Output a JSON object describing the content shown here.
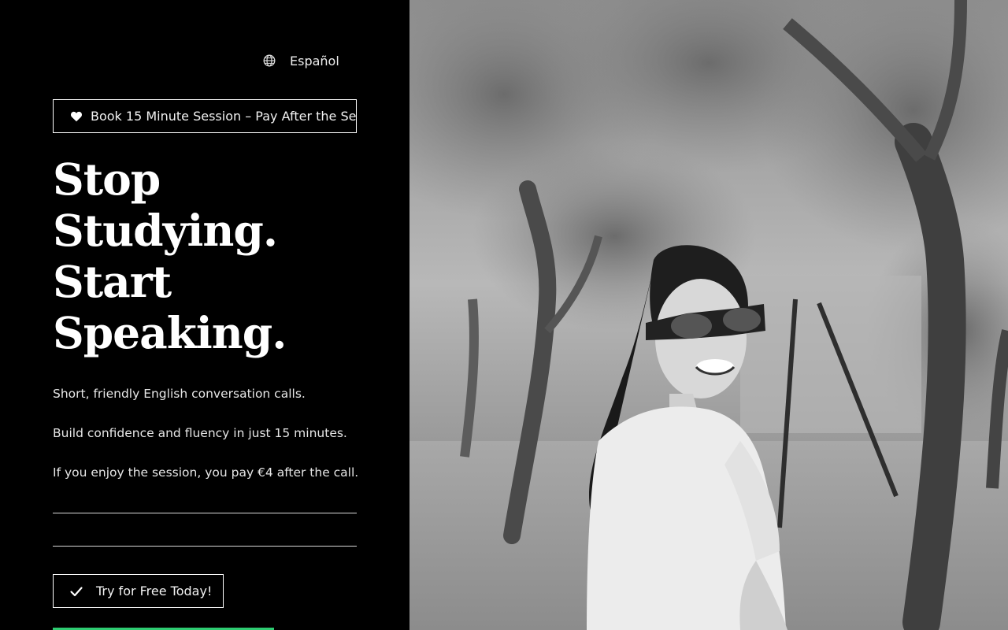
{
  "language_switch": {
    "label": "Español",
    "icon": "globe-icon"
  },
  "book_button": {
    "label": "Book 15 Minute Session – Pay After the Se",
    "icon": "heart-icon"
  },
  "headline": {
    "line1": "Stop",
    "line2": "Studying.",
    "line3": "Start",
    "line4": "Speaking."
  },
  "description": {
    "line1": "Short, friendly English conversation calls.",
    "line2": "Build confidence and fluency in just 15 minutes.",
    "line3": "If you enjoy the session, you pay €4 after the call."
  },
  "try_button": {
    "label": "Try for Free Today!",
    "icon": "check-icon"
  },
  "colors": {
    "background": "#000000",
    "text": "#ffffff",
    "accent": "#2ecc71"
  },
  "hero_image": {
    "description_icon": "photo-woman-in-park"
  }
}
